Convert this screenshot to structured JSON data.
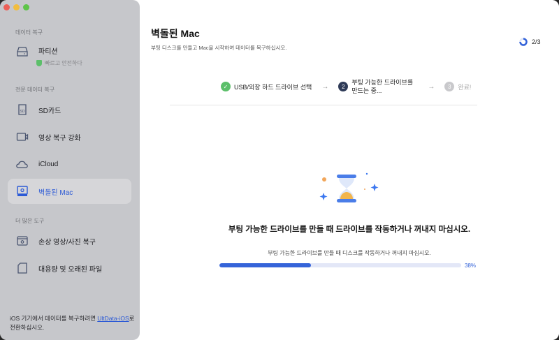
{
  "sidebar": {
    "sections": [
      "데이터 복구",
      "전문 데이터 복구",
      "더 많은 도구"
    ],
    "items": [
      {
        "label": "파티션",
        "sub": "빠르고 안전하다"
      },
      {
        "label": "SD카드"
      },
      {
        "label": "영상 복구 강화"
      },
      {
        "label": "iCloud"
      },
      {
        "label": "벽돌된 Mac"
      },
      {
        "label": "손상 영상/사진 복구"
      },
      {
        "label": "대용량 및 오래된 파일"
      }
    ],
    "footer_pre": "iOS 기기에서 데이터를 복구하려면 ",
    "footer_link": "UltData-iOS",
    "footer_post": "로 전환하십시오."
  },
  "header": {
    "title": "벽돌된 Mac",
    "subtitle": "부팅 디스크를 만들고 Mac을 시작하여 데이터를 복구하십시오.",
    "page": "2/3"
  },
  "steps": [
    {
      "num": "✓",
      "label": "USB/외장 하드 드라이브 선택"
    },
    {
      "num": "2",
      "label": "부팅 가능한 드라이브를 만드는 중..."
    },
    {
      "num": "3",
      "label": "완료!"
    }
  ],
  "status": {
    "message": "부팅 가능한 드라이브를 만들 때 드라이브를 작동하거나 꺼내지 마십시오.",
    "detail": "부팅 가능한 드라이브를 만들 때 디스크를 작동하거나 꺼내지 마십시오.",
    "progress": 38,
    "progress_label": "38%"
  },
  "colors": {
    "accent": "#3564d9",
    "success": "#5cbf6a"
  }
}
